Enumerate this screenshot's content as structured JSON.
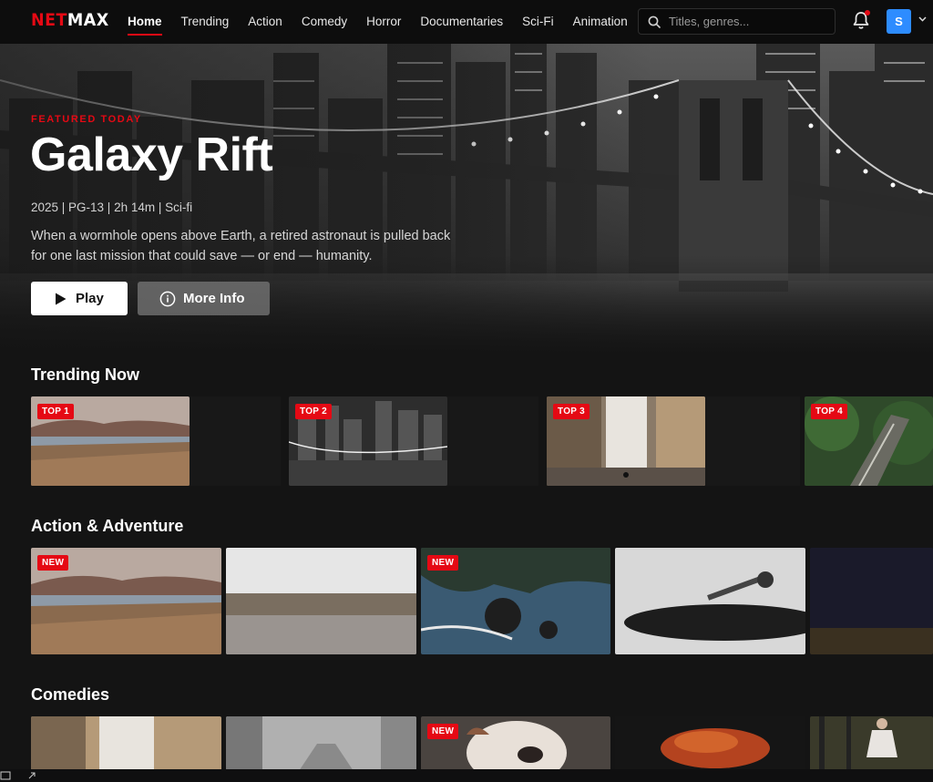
{
  "nav": {
    "logo_part1": "NET",
    "logo_part2": "MAX",
    "links": [
      {
        "label": "Home",
        "active": true
      },
      {
        "label": "Trending",
        "active": false
      },
      {
        "label": "Action",
        "active": false
      },
      {
        "label": "Comedy",
        "active": false
      },
      {
        "label": "Horror",
        "active": false
      },
      {
        "label": "Documentaries",
        "active": false
      },
      {
        "label": "Sci-Fi",
        "active": false
      },
      {
        "label": "Animation",
        "active": false
      }
    ],
    "search_placeholder": "Titles, genres...",
    "search_icon": "search-icon",
    "bell_icon": "bell-icon",
    "avatar_initial": "S",
    "caret_icon": "chevron-down-icon"
  },
  "hero": {
    "kicker": "FEATURED TODAY",
    "title": "Galaxy Rift",
    "meta": "2025 | PG-13 | 2h 14m | Sci-fi",
    "description": "When a wormhole opens above Earth, a retired astronaut is pulled back for one last mission that could save — or end — humanity.",
    "play_label": "Play",
    "info_label": "More Info"
  },
  "rows": {
    "trending": {
      "title": "Trending Now",
      "badges": [
        "TOP 1",
        "TOP 2",
        "TOP 3",
        "TOP 4"
      ]
    },
    "action": {
      "title": "Action & Adventure",
      "badges": [
        "NEW",
        "",
        "NEW",
        "",
        ""
      ]
    },
    "comedies": {
      "title": "Comedies",
      "badges": [
        "",
        "",
        "NEW",
        "",
        ""
      ]
    }
  },
  "colors": {
    "brand_red": "#e50914",
    "background": "#141414",
    "avatar_blue": "#2d8cff"
  }
}
